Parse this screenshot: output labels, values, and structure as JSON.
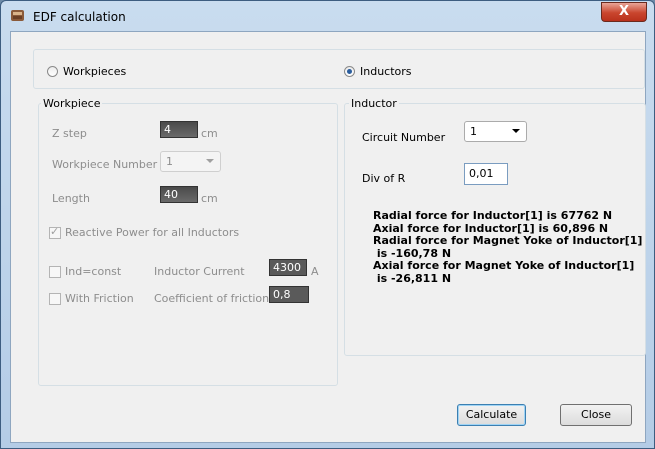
{
  "window": {
    "title": "EDF calculation",
    "close_glyph": "X"
  },
  "mode": {
    "workpieces_label": "Workpieces",
    "inductors_label": "Inductors",
    "selected": "Inductors"
  },
  "workpiece": {
    "legend": "Workpiece",
    "z_step_label": "Z step",
    "z_step_value": "4",
    "z_step_unit": "cm",
    "number_label": "Workpiece Number",
    "number_value": "1",
    "length_label": "Length",
    "length_value": "40",
    "length_unit": "cm",
    "reactive_power_label": "Reactive Power for all Inductors",
    "ind_const_label": "Ind=const",
    "current_label": "Inductor Current",
    "current_value": "4300",
    "current_unit": "A",
    "with_friction_label": "With Friction",
    "friction_label": "Coefficient of friction",
    "friction_value": "0,8"
  },
  "inductor": {
    "legend": "Inductor",
    "circuit_label": "Circuit Number",
    "circuit_value": "1",
    "div_r_label": "Div of R",
    "div_r_value": "0,01",
    "results": [
      "Radial force for Inductor[1] is 67762 N",
      "Axial force for Inductor[1] is 60,896 N",
      "Radial force for Magnet Yoke of Inductor[1]",
      " is -160,78 N",
      "Axial force for Magnet Yoke of Inductor[1]",
      " is -26,811 N"
    ]
  },
  "buttons": {
    "calculate": "Calculate",
    "close": "Close"
  }
}
